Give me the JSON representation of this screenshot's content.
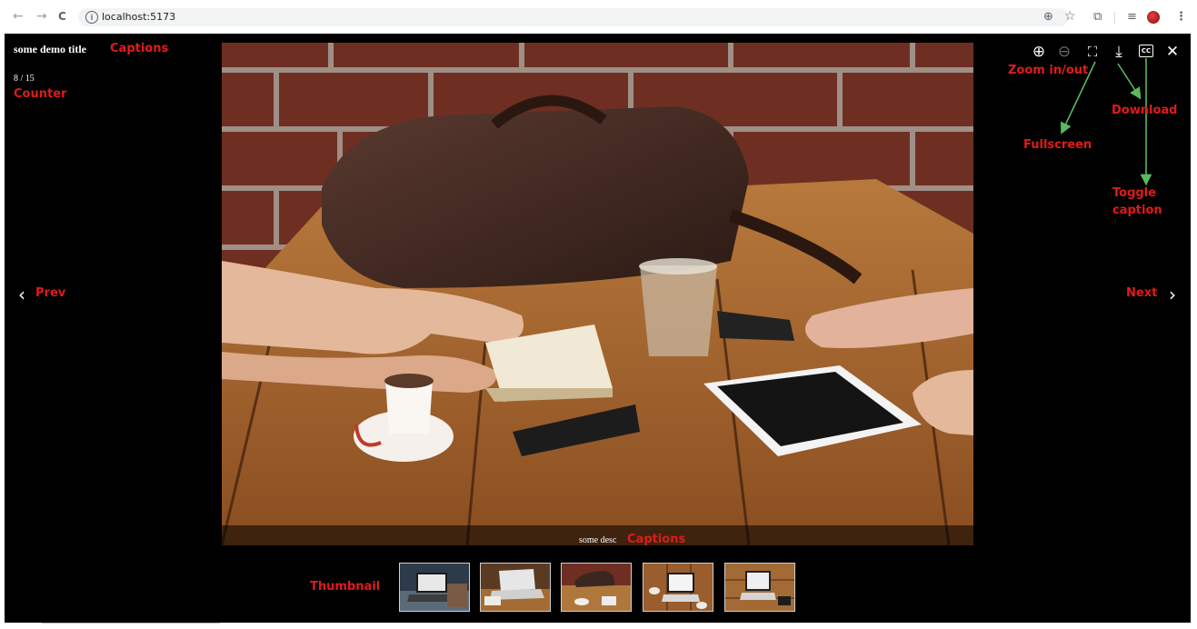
{
  "browser": {
    "url": "localhost:5173",
    "back_icon": "←",
    "forward_icon": "→",
    "reload_icon": "C",
    "zoom_icon": "⊕",
    "star_icon": "☆",
    "extensions_icon": "⧉",
    "media_icon": "≡",
    "menu_icon": "⋮"
  },
  "viewer": {
    "title": "some demo title",
    "counter": "8 / 15",
    "description": "some desc",
    "prev_icon": "‹",
    "next_icon": "›",
    "toolbar": {
      "zoom_in_icon": "⊕",
      "zoom_out_icon": "⊖",
      "fullscreen_icon": "⛶",
      "download_icon": "⤓",
      "caption_label": "CC",
      "close_icon": "✕"
    }
  },
  "annotations": {
    "captions_top": "Captions",
    "counter": "Counter",
    "zoom": "Zoom in/out",
    "fullscreen": "Fullscreen",
    "download": "Download",
    "toggle_caption": "Toggle caption",
    "prev": "Prev",
    "next": "Next",
    "captions_bottom": "Captions",
    "thumbnail": "Thumbnail"
  },
  "colors": {
    "annotation_text": "#e01b1b",
    "annotation_arrow": "#5cb85c",
    "viewer_background": "#000000"
  }
}
